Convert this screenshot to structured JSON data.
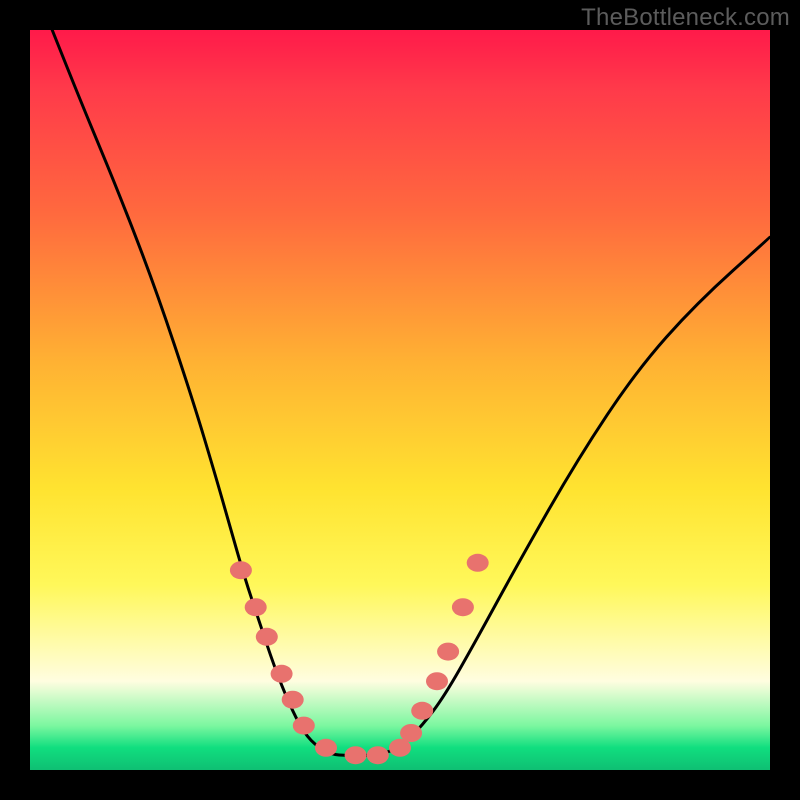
{
  "watermark": "TheBottleneck.com",
  "chart_data": {
    "type": "line",
    "title": "",
    "xlabel": "",
    "ylabel": "",
    "xlim": [
      0,
      100
    ],
    "ylim": [
      0,
      100
    ],
    "series": [
      {
        "name": "bottleneck-curve",
        "x": [
          3,
          7,
          12,
          17,
          22,
          25,
          27,
          29,
          31,
          33,
          35,
          37,
          39,
          41,
          44,
          47,
          50,
          53,
          56,
          60,
          66,
          74,
          82,
          90,
          100
        ],
        "y": [
          100,
          90,
          78,
          65,
          50,
          40,
          33,
          26,
          20,
          14,
          9,
          5,
          3,
          2,
          2,
          2,
          3,
          6,
          10,
          17,
          28,
          42,
          54,
          63,
          72
        ]
      },
      {
        "name": "markers",
        "x": [
          28.5,
          30.5,
          32,
          34,
          35.5,
          37,
          40,
          44,
          47,
          50,
          51.5,
          53,
          55,
          56.5,
          58.5,
          60.5
        ],
        "y": [
          27,
          22,
          18,
          13,
          9.5,
          6,
          3,
          2,
          2,
          3,
          5,
          8,
          12,
          16,
          22,
          28
        ]
      }
    ],
    "gradient_stops": [
      {
        "pos": 0,
        "color": "#ff1a4a"
      },
      {
        "pos": 25,
        "color": "#ff6a3e"
      },
      {
        "pos": 60,
        "color": "#ffe330"
      },
      {
        "pos": 90,
        "color": "#fffde0"
      },
      {
        "pos": 100,
        "color": "#0fbf73"
      }
    ],
    "marker_color": "#e8726e",
    "curve_color": "#000000"
  }
}
